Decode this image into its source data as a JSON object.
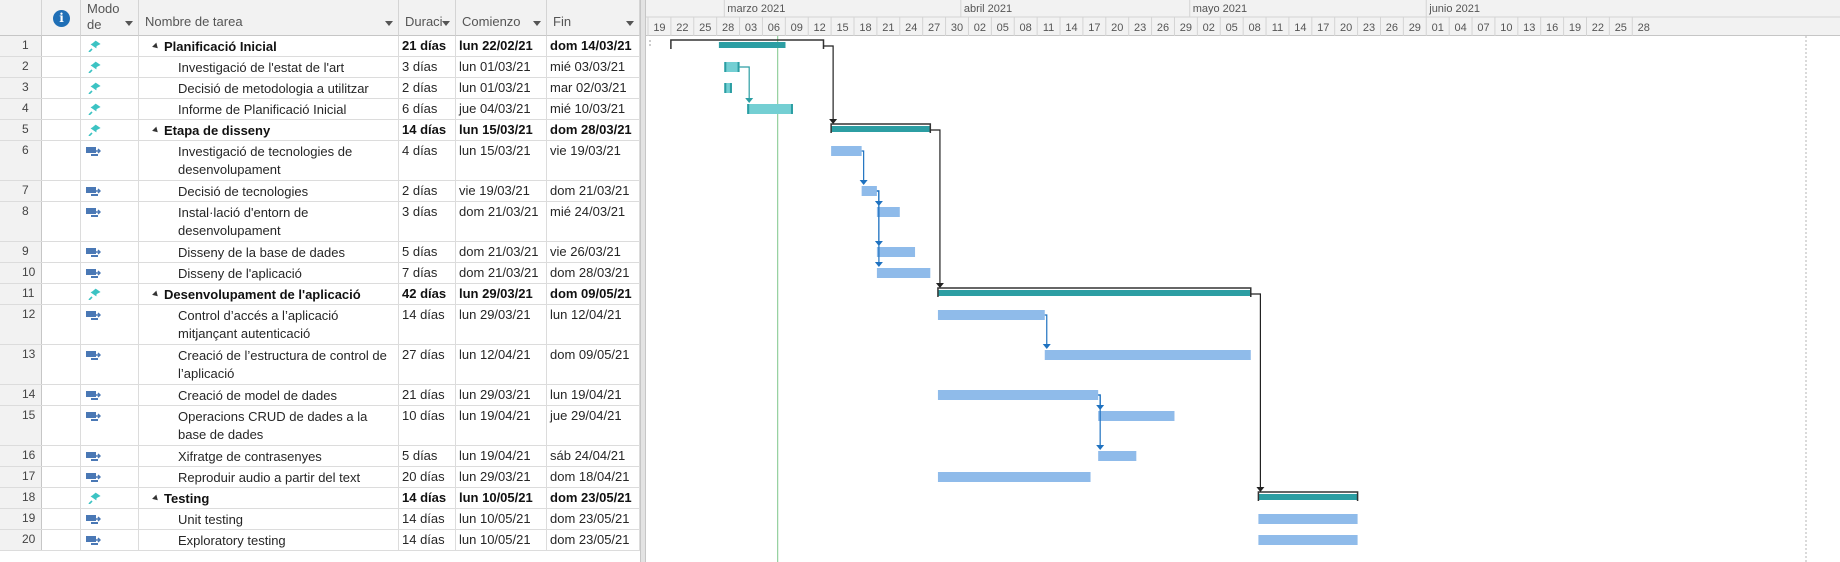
{
  "columns": {
    "mode_line1": "Modo",
    "mode_line2": "de",
    "name": "Nombre de tarea",
    "duration": "Duraci",
    "start": "Comienzo",
    "finish": "Fin",
    "info_icon": "info-icon"
  },
  "timescale": {
    "months": [
      "marzo 2021",
      "abril 2021",
      "mayo 2021",
      "junio 2021"
    ],
    "days": [
      "19",
      "22",
      "25",
      "28",
      "03",
      "06",
      "09",
      "12",
      "15",
      "18",
      "21",
      "24",
      "27",
      "30",
      "02",
      "05",
      "08",
      "11",
      "14",
      "17",
      "20",
      "23",
      "26",
      "29",
      "02",
      "05",
      "08",
      "11",
      "14",
      "17",
      "20",
      "23",
      "26",
      "29",
      "01",
      "04",
      "07",
      "10",
      "13",
      "16",
      "19",
      "22",
      "25",
      "28"
    ]
  },
  "colors": {
    "summary_bar": "#2c9ea3",
    "manual_bar": "#74cfd3",
    "auto_bar": "#8fbbea",
    "link": "#1f72c0",
    "current_date": "#7cc68a",
    "manual_pin": "#3cc3c3",
    "auto_icon": "#4a78b5"
  },
  "tasks": [
    {
      "id": "1",
      "mode": "manual",
      "level": 0,
      "summary": true,
      "name": "Planificació Inicial",
      "duration": "21 días",
      "start": "lun 22/02/21",
      "finish": "dom 14/03/21"
    },
    {
      "id": "2",
      "mode": "manual",
      "level": 1,
      "summary": false,
      "name": "Investigació de l'estat de l'art",
      "duration": "3 días",
      "start": "lun 01/03/21",
      "finish": "mié 03/03/21"
    },
    {
      "id": "3",
      "mode": "manual",
      "level": 1,
      "summary": false,
      "name": "Decisió de metodologia a utilitzar",
      "duration": "2 días",
      "start": "lun 01/03/21",
      "finish": "mar 02/03/21"
    },
    {
      "id": "4",
      "mode": "manual",
      "level": 1,
      "summary": false,
      "name": "Informe de Planificació Inicial",
      "duration": "6 días",
      "start": "jue 04/03/21",
      "finish": "mié 10/03/21"
    },
    {
      "id": "5",
      "mode": "manual",
      "level": 0,
      "summary": true,
      "name": "Etapa de disseny",
      "duration": "14 días",
      "start": "lun 15/03/21",
      "finish": "dom 28/03/21"
    },
    {
      "id": "6",
      "mode": "auto",
      "level": 1,
      "summary": false,
      "name": "Investigació de tecnologies de desenvolupament",
      "duration": "4 días",
      "start": "lun 15/03/21",
      "finish": "vie 19/03/21"
    },
    {
      "id": "7",
      "mode": "auto",
      "level": 1,
      "summary": false,
      "name": "Decisió de tecnologies",
      "duration": "2 días",
      "start": "vie 19/03/21",
      "finish": "dom 21/03/21"
    },
    {
      "id": "8",
      "mode": "auto",
      "level": 1,
      "summary": false,
      "name": "Instal·lació d'entorn de desenvolupament",
      "duration": "3 días",
      "start": "dom 21/03/21",
      "finish": "mié 24/03/21"
    },
    {
      "id": "9",
      "mode": "auto",
      "level": 1,
      "summary": false,
      "name": "Disseny de la base de dades",
      "duration": "5 días",
      "start": "dom 21/03/21",
      "finish": "vie 26/03/21"
    },
    {
      "id": "10",
      "mode": "auto",
      "level": 1,
      "summary": false,
      "name": "Disseny de l'aplicació",
      "duration": "7 días",
      "start": "dom 21/03/21",
      "finish": "dom 28/03/21"
    },
    {
      "id": "11",
      "mode": "manual",
      "level": 0,
      "summary": true,
      "name": "Desenvolupament de l'aplicació",
      "duration": "42 días",
      "start": "lun 29/03/21",
      "finish": "dom 09/05/21"
    },
    {
      "id": "12",
      "mode": "auto",
      "level": 1,
      "summary": false,
      "name": "Control d’accés a l’aplicació mitjançant autenticació",
      "duration": "14 días",
      "start": "lun 29/03/21",
      "finish": "lun 12/04/21"
    },
    {
      "id": "13",
      "mode": "auto",
      "level": 1,
      "summary": false,
      "name": "Creació de l’estructura de control de l’aplicació",
      "duration": "27 días",
      "start": "lun 12/04/21",
      "finish": "dom 09/05/21"
    },
    {
      "id": "14",
      "mode": "auto",
      "level": 1,
      "summary": false,
      "name": "Creació de model de dades",
      "duration": "21 días",
      "start": "lun 29/03/21",
      "finish": "lun 19/04/21"
    },
    {
      "id": "15",
      "mode": "auto",
      "level": 1,
      "summary": false,
      "name": "Operacions CRUD de dades a la base de dades",
      "duration": "10 días",
      "start": "lun 19/04/21",
      "finish": "jue 29/04/21"
    },
    {
      "id": "16",
      "mode": "auto",
      "level": 1,
      "summary": false,
      "name": "Xifratge de contrasenyes",
      "duration": "5 días",
      "start": "lun 19/04/21",
      "finish": "sáb 24/04/21"
    },
    {
      "id": "17",
      "mode": "auto",
      "level": 1,
      "summary": false,
      "name": "Reproduir audio a partir del text",
      "duration": "20 días",
      "start": "lun 29/03/21",
      "finish": "dom 18/04/21"
    },
    {
      "id": "18",
      "mode": "manual",
      "level": 0,
      "summary": true,
      "name": "Testing",
      "duration": "14 días",
      "start": "lun 10/05/21",
      "finish": "dom 23/05/21"
    },
    {
      "id": "19",
      "mode": "auto",
      "level": 1,
      "summary": false,
      "name": "Unit testing",
      "duration": "14 días",
      "start": "lun 10/05/21",
      "finish": "dom 23/05/21"
    },
    {
      "id": "20",
      "mode": "auto",
      "level": 1,
      "summary": false,
      "name": "Exploratory testing",
      "duration": "14 días",
      "start": "lun 10/05/21",
      "finish": "dom 23/05/21"
    }
  ]
}
